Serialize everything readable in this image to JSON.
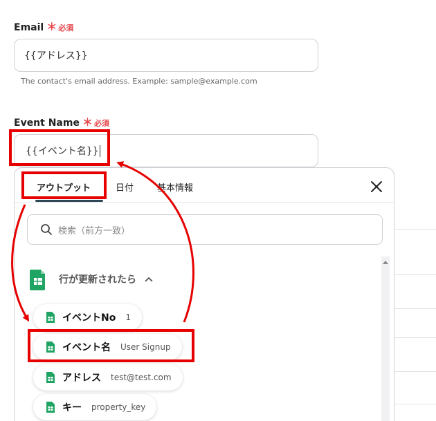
{
  "email_field": {
    "label": "Email",
    "required_star": "＊",
    "required_text": "必須",
    "value": "{{アドレス}}",
    "help": "The contact's email address. Example: sample@example.com"
  },
  "event_field": {
    "label": "Event Name",
    "required_star": "＊",
    "required_text": "必須",
    "value": "{{イベント名}}"
  },
  "popup": {
    "tabs": [
      {
        "label": "アウトプット"
      },
      {
        "label": "日付"
      },
      {
        "label": "基本情報"
      }
    ],
    "search_placeholder": "検索（前方一致）",
    "group_title": "行が更新されたら",
    "items": [
      {
        "name": "イベントNo",
        "value": "1"
      },
      {
        "name": "イベント名",
        "value": "User Signup"
      },
      {
        "name": "アドレス",
        "value": "test@test.com"
      },
      {
        "name": "キー",
        "value": "property_key"
      }
    ]
  },
  "colors": {
    "accent": "#2f4858",
    "required": "#e5484d",
    "annotation_red": "#e60000",
    "sheets_green": "#1fa463"
  }
}
